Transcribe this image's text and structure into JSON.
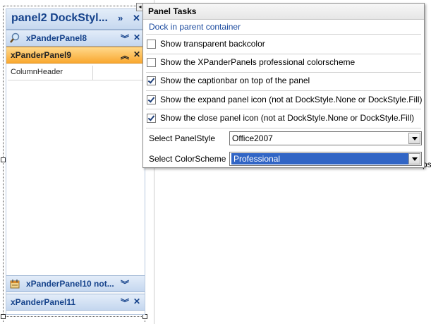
{
  "designer": {
    "panel_title": "panel2 DockStyl...",
    "column_header": "ColumnHeader",
    "panels": [
      {
        "label": "xPanderPanel8",
        "style": "blue",
        "expand_icon": "double-chevron-down-icon"
      },
      {
        "label": "xPanderPanel9",
        "style": "orange",
        "expand_icon": "double-chevron-up-icon"
      },
      {
        "label": "xPanderPanel10 not...",
        "style": "blue",
        "expand_icon": "double-chevron-down-icon"
      },
      {
        "label": "xPanderPanel11",
        "style": "blue",
        "expand_icon": "double-chevron-down-icon"
      }
    ],
    "caption_buttons": {
      "expand": "»",
      "close": "✕"
    },
    "panel_buttons": {
      "expand_down": "︾",
      "expand_up": "︽",
      "close": "✕"
    }
  },
  "tasks": {
    "title": "Panel Tasks",
    "link": "Dock in parent container",
    "checkboxes": [
      {
        "label": "Show transparent backcolor",
        "checked": false
      },
      {
        "label": "Show the XPanderPanels professional colorscheme",
        "checked": false
      },
      {
        "label": "Show the captionbar on top of the panel",
        "checked": true
      },
      {
        "label": "Show the expand panel icon (not at DockStyle.None or DockStyle.Fill)",
        "checked": true
      },
      {
        "label": "Show the close panel icon (not at DockStyle.None or DockStyle.Fill)",
        "checked": true
      }
    ],
    "panel_style": {
      "label": "Select PanelStyle",
      "value": "Office2007"
    },
    "color_scheme": {
      "label": "Select ColorScheme",
      "value": "Professional"
    }
  },
  "background": {
    "clipped_text": "ps"
  },
  "colors": {
    "caption_blue": "#15428b",
    "selected_orange": "#f9a830",
    "link_blue": "#1b4a9e",
    "focus_blue": "#3165c5"
  }
}
